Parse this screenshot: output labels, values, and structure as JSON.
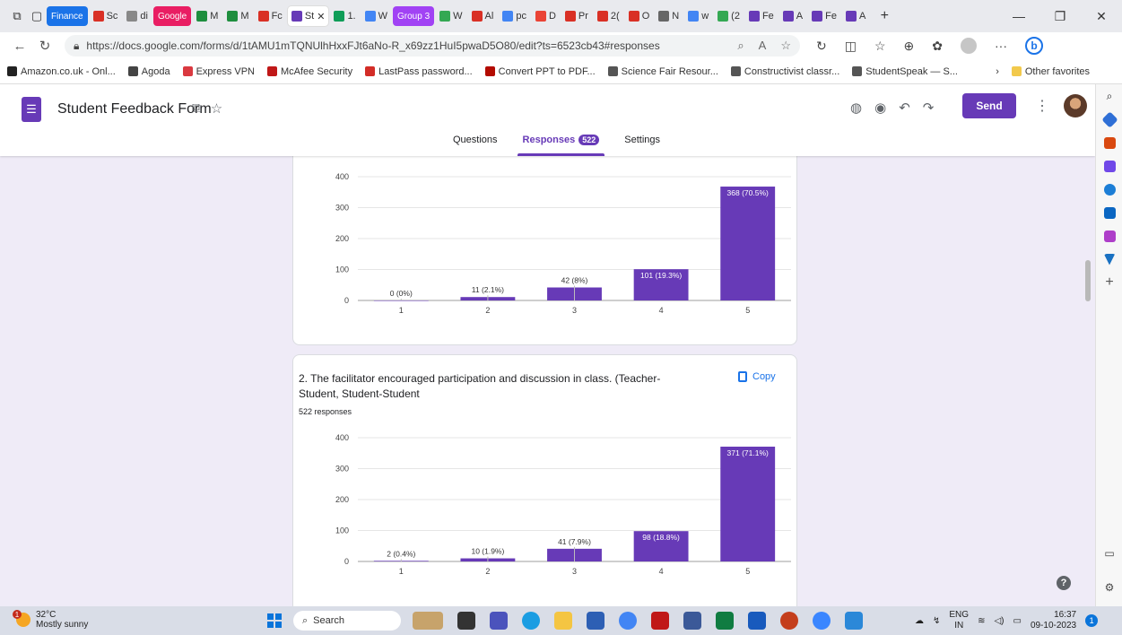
{
  "browser": {
    "tabs": [
      {
        "label": "Finance",
        "type": "group",
        "color": "#1a73e8"
      },
      {
        "label": "Sc",
        "type": "tab",
        "icon_color": "#d93025"
      },
      {
        "label": "di",
        "type": "tab",
        "icon_color": "#888888"
      },
      {
        "label": "Google",
        "type": "group",
        "color": "#e91e63"
      },
      {
        "label": "M",
        "type": "tab",
        "icon_color": "#1e8e3e"
      },
      {
        "label": "M",
        "type": "tab",
        "icon_color": "#1e8e3e"
      },
      {
        "label": "Fc",
        "type": "tab",
        "icon_color": "#d93025"
      },
      {
        "label": "St",
        "type": "tab",
        "active": true,
        "icon_color": "#673ab7"
      },
      {
        "label": "1.",
        "type": "tab",
        "icon_color": "#0f9d58"
      },
      {
        "label": "W",
        "type": "tab",
        "icon_color": "#4285f4"
      },
      {
        "label": "Group 3",
        "type": "group",
        "color": "#a142f4"
      },
      {
        "label": "W",
        "type": "tab",
        "icon_color": "#34a853"
      },
      {
        "label": "Al",
        "type": "tab",
        "icon_color": "#d93025"
      },
      {
        "label": "pc",
        "type": "tab",
        "icon_color": "#4285f4"
      },
      {
        "label": "D",
        "type": "tab",
        "icon_color": "#ea4335"
      },
      {
        "label": "Pr",
        "type": "tab",
        "icon_color": "#d93025"
      },
      {
        "label": "2(",
        "type": "tab",
        "icon_color": "#d93025"
      },
      {
        "label": "O",
        "type": "tab",
        "icon_color": "#d93025"
      },
      {
        "label": "N",
        "type": "tab",
        "icon_color": "#666666"
      },
      {
        "label": "w",
        "type": "tab",
        "icon_color": "#4285f4"
      },
      {
        "label": "(2",
        "type": "tab",
        "icon_color": "#34a853"
      },
      {
        "label": "Fe",
        "type": "tab",
        "icon_color": "#673ab7"
      },
      {
        "label": "A",
        "type": "tab",
        "icon_color": "#673ab7"
      },
      {
        "label": "Fe",
        "type": "tab",
        "icon_color": "#673ab7"
      },
      {
        "label": "A",
        "type": "tab",
        "icon_color": "#673ab7"
      }
    ],
    "new_tab": "+",
    "url": "https://docs.google.com/forms/d/1tAMU1mTQNUlhHxxFJt6aNo-R_x69zz1HuI5pwaD5O80/edit?ts=6523cb43#responses",
    "bookmarks": [
      {
        "label": "Amazon.co.uk - Onl...",
        "color": "#222222"
      },
      {
        "label": "Agoda",
        "color": "#444444"
      },
      {
        "label": "Express VPN",
        "color": "#da3940"
      },
      {
        "label": "McAfee Security",
        "color": "#c01818"
      },
      {
        "label": "LastPass password...",
        "color": "#d32d27"
      },
      {
        "label": "Convert PPT to PDF...",
        "color": "#b30b00"
      },
      {
        "label": "Science Fair Resour...",
        "color": "#555555"
      },
      {
        "label": "Constructivist classr...",
        "color": "#555555"
      },
      {
        "label": "StudentSpeak — S...",
        "color": "#555555"
      }
    ],
    "other_favorites": "Other favorites"
  },
  "form": {
    "title": "Student Feedback Form",
    "send_label": "Send",
    "tabs": {
      "questions": "Questions",
      "responses": "Responses",
      "responses_count": "522",
      "settings": "Settings"
    },
    "accent": "#673ab7"
  },
  "question2": {
    "title": "2.   The facilitator encouraged participation and discussion in class. (Teacher-Student, Student-Student",
    "copy_label": "Copy",
    "responses": "522 responses"
  },
  "chart_data": [
    {
      "type": "bar",
      "categories": [
        "1",
        "2",
        "3",
        "4",
        "5"
      ],
      "values": [
        0,
        11,
        42,
        101,
        368
      ],
      "labels": [
        "0 (0%)",
        "11 (2.1%)",
        "42 (8%)",
        "101 (19.3%)",
        "368 (70.5%)"
      ],
      "yticks": [
        0,
        100,
        200,
        300,
        400
      ],
      "ylim": [
        0,
        400
      ],
      "grid": true,
      "color": "#673ab7"
    },
    {
      "type": "bar",
      "categories": [
        "1",
        "2",
        "3",
        "4",
        "5"
      ],
      "values": [
        2,
        10,
        41,
        98,
        371
      ],
      "labels": [
        "2 (0.4%)",
        "10 (1.9%)",
        "41 (7.9%)",
        "98 (18.8%)",
        "371 (71.1%)"
      ],
      "yticks": [
        0,
        100,
        200,
        300,
        400
      ],
      "ylim": [
        0,
        400
      ],
      "grid": true,
      "color": "#673ab7"
    }
  ],
  "taskbar": {
    "temperature": "32°C",
    "weather": "Mostly sunny",
    "weather_badge": "1",
    "search_placeholder": "Search",
    "lang": "ENG",
    "region": "IN",
    "time": "16:37",
    "date": "09-10-2023"
  }
}
